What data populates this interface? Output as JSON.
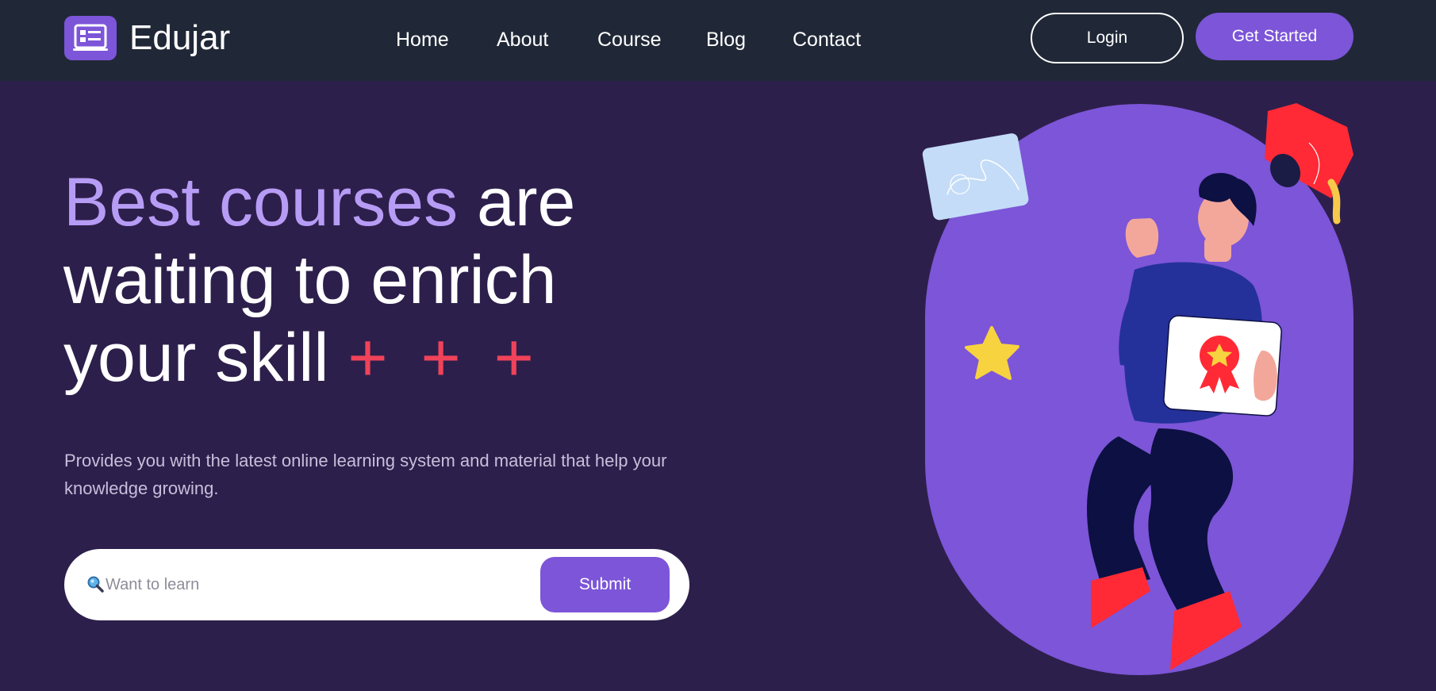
{
  "app": {
    "brand": "Edujar",
    "logo_icon": "laptop-list-icon",
    "colors": {
      "header_bg": "#202837",
      "page_bg": "#2d1f4b",
      "accent": "#7c55d8",
      "accent_light": "#b79cf6",
      "plus_red": "#f0435a"
    }
  },
  "nav": {
    "items": [
      {
        "label": "Home"
      },
      {
        "label": "About"
      },
      {
        "label": "Course"
      },
      {
        "label": "Blog"
      },
      {
        "label": "Contact"
      }
    ]
  },
  "header": {
    "login_label": "Login",
    "get_started_label": "Get Started"
  },
  "hero": {
    "title_accent": "Best courses",
    "title_rest_1": " are",
    "title_line_2": "waiting to enrich",
    "title_line_3": "your skill",
    "plus_marks": "+ + +",
    "description": "Provides you with the latest online learning system and material that help your knowledge growing."
  },
  "search": {
    "icon": "magnifier-icon",
    "placeholder": "Want to learn",
    "value": "",
    "submit_label": "Submit"
  },
  "illustration": {
    "subject": "student-holding-certificate-illustration",
    "elements": [
      "certificate-icon",
      "graduation-cap-icon",
      "star-icon",
      "laptop-screen-icon"
    ]
  }
}
